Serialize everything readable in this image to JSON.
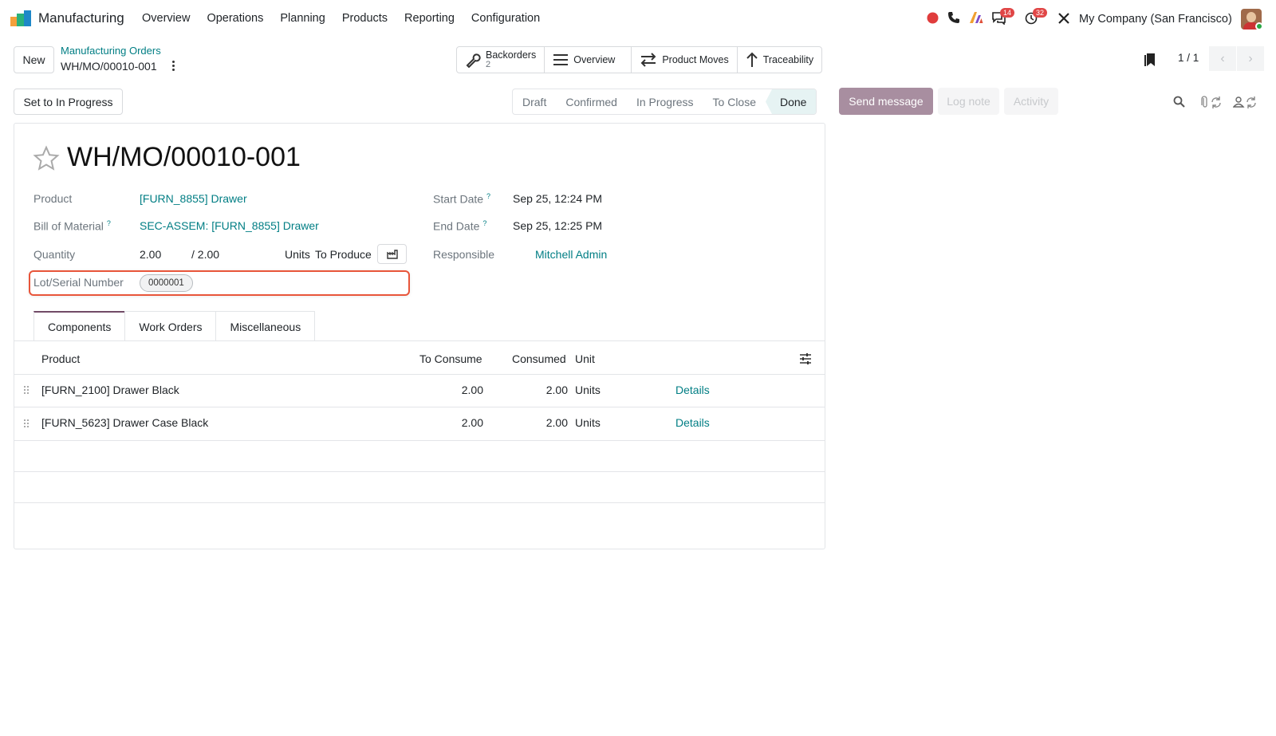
{
  "navbar": {
    "app_name": "Manufacturing",
    "menu": [
      "Overview",
      "Operations",
      "Planning",
      "Products",
      "Reporting",
      "Configuration"
    ],
    "messages_badge": "14",
    "activities_badge": "32",
    "company": "My Company (San Francisco)"
  },
  "control": {
    "new_label": "New",
    "breadcrumb_parent": "Manufacturing Orders",
    "breadcrumb_current": "WH/MO/00010-001",
    "smart_buttons": {
      "backorders_label": "Backorders",
      "backorders_count": "2",
      "overview_label": "Overview",
      "product_moves_label": "Product Moves",
      "traceability_label": "Traceability"
    },
    "pager": "1 / 1"
  },
  "header": {
    "set_in_progress_label": "Set to In Progress",
    "stages": [
      "Draft",
      "Confirmed",
      "In Progress",
      "To Close",
      "Done"
    ],
    "active_stage": "Done"
  },
  "chatter": {
    "send_message": "Send message",
    "log_note": "Log note",
    "activity": "Activity"
  },
  "form": {
    "title": "WH/MO/00010-001",
    "product_label": "Product",
    "product_value": "[FURN_8855] Drawer",
    "bom_label": "Bill of Material",
    "bom_value": "SEC-ASSEM: [FURN_8855] Drawer",
    "quantity_label": "Quantity",
    "quantity_value": "2.00",
    "quantity_total": "/ 2.00",
    "units_label": "Units",
    "to_produce_label": "To Produce",
    "lot_label": "Lot/Serial Number",
    "lot_value": "0000001",
    "start_date_label": "Start Date",
    "start_date_value": "Sep 25, 12:24 PM",
    "end_date_label": "End Date",
    "end_date_value": "Sep 25, 12:25 PM",
    "responsible_label": "Responsible",
    "responsible_value": "Mitchell Admin",
    "help_mark": "?"
  },
  "tabs": [
    "Components",
    "Work Orders",
    "Miscellaneous"
  ],
  "table": {
    "headers": {
      "product": "Product",
      "to_consume": "To Consume",
      "consumed": "Consumed",
      "unit": "Unit"
    },
    "rows": [
      {
        "product": "[FURN_2100] Drawer Black",
        "to_consume": "2.00",
        "consumed": "2.00",
        "unit": "Units",
        "action": "Details"
      },
      {
        "product": "[FURN_5623] Drawer Case Black",
        "to_consume": "2.00",
        "consumed": "2.00",
        "unit": "Units",
        "action": "Details"
      }
    ]
  }
}
